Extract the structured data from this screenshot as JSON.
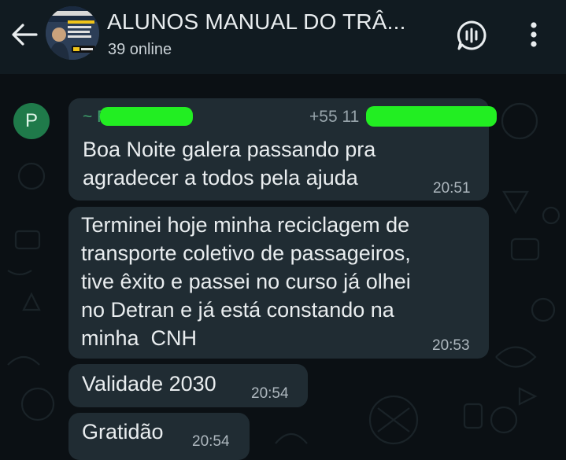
{
  "header": {
    "title": "ALUNOS MANUAL DO TRÂ...",
    "subtitle": "39 online"
  },
  "messages": [
    {
      "sender_initial": "P",
      "sender_name": "~ P",
      "sender_phone": "+55 11",
      "text": "Boa Noite galera passando pra\nagradecer a todos pela ajuda",
      "time": "20:51"
    },
    {
      "text": "Terminei hoje minha reciclagem de\ntransporte coletivo de passageiros,\ntive êxito e passei no curso já olhei\nno Detran e já está constando na\nminha  CNH",
      "time": "20:53"
    },
    {
      "text": "Validade 2030",
      "time": "20:54"
    },
    {
      "text": "Gratidão",
      "time": "20:54"
    }
  ]
}
